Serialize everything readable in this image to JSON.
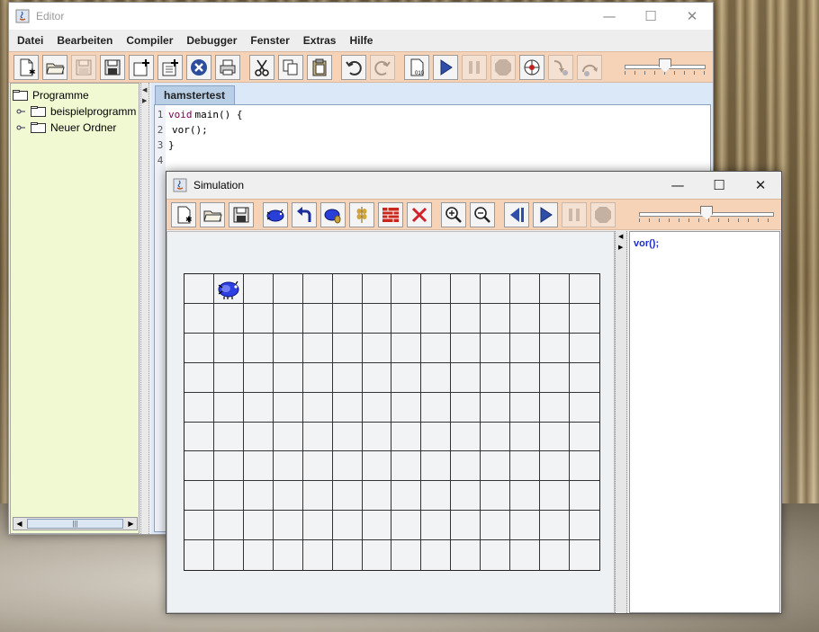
{
  "editor": {
    "title": "Editor",
    "menu": [
      "Datei",
      "Bearbeiten",
      "Compiler",
      "Debugger",
      "Fenster",
      "Extras",
      "Hilfe"
    ],
    "toolbar_icons": [
      "new-file-icon",
      "open-folder-icon",
      "save-icon",
      "save-as-icon",
      "new-class-icon",
      "new-program-icon",
      "close-icon",
      "print-icon",
      "cut-icon",
      "copy-icon",
      "paste-icon",
      "undo-icon",
      "redo-icon",
      "compile-icon",
      "play-icon",
      "pause-icon",
      "stop-icon",
      "debug-icon",
      "step-into-icon",
      "step-over-icon"
    ],
    "speed_slider_value": 0.5,
    "tree": {
      "root": "Programme",
      "items": [
        "beispielprogramm",
        "Neuer Ordner"
      ]
    },
    "tab": "hamstertest",
    "code_lines": [
      {
        "no": "1",
        "keyword": "void",
        "text": "main() {"
      },
      {
        "no": "2",
        "keyword": "",
        "text": "vor();"
      },
      {
        "no": "3",
        "keyword": "",
        "text": "}"
      },
      {
        "no": "4",
        "keyword": "",
        "text": ""
      }
    ]
  },
  "simulation": {
    "title": "Simulation",
    "toolbar_icons": [
      "new-territory-icon",
      "open-territory-icon",
      "save-territory-icon",
      "place-hamster-icon",
      "turn-left-icon",
      "grain-in-mouth-icon",
      "place-grain-icon",
      "place-wall-icon",
      "delete-icon",
      "zoom-in-icon",
      "zoom-out-icon",
      "step-back-icon",
      "play-icon",
      "pause-icon",
      "stop-icon"
    ],
    "speed_slider_value": 0.5,
    "grid": {
      "rows": 10,
      "cols": 14,
      "hamster_row": 0,
      "hamster_col": 1
    },
    "log": [
      "vor();"
    ]
  },
  "window_controls": {
    "minimize": "—",
    "maximize": "☐",
    "close": "✕"
  },
  "colors": {
    "toolbar": "#f6d3b6",
    "tree": "#f1f9d3",
    "log_text": "#1d2ec8",
    "keyword": "#7a0055"
  }
}
